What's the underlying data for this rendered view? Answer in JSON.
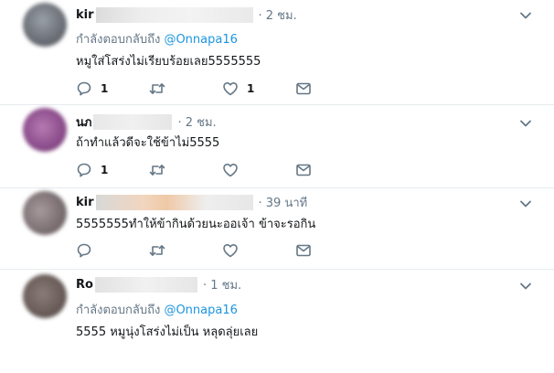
{
  "tweets": [
    {
      "name": "kir",
      "time": "· 2 ชม.",
      "replying_prefix": "กำลังตอบกลับถึง",
      "replying_handle": "@Onnapa16",
      "text": "หมูใส่โสร่งไม่เรียบร้อยเลย5555555",
      "reply_count": "1",
      "like_count": "1"
    },
    {
      "name": "นภ",
      "time": "· 2 ชม.",
      "text": "ถ้าทำแล้วดีจะใช้ข้าไม่5555",
      "reply_count": "1"
    },
    {
      "name": "kir",
      "time": "· 39 นาที",
      "text": "5555555ทำให้ข้ากินด้วยนะออเจ้า ข้าจะรอกิน"
    },
    {
      "name": "Ro",
      "time": "· 1 ชม.",
      "replying_prefix": "กำลังตอบกลับถึง",
      "replying_handle": "@Onnapa16",
      "text": "5555 หมูนุ่งโสร่งไม่เป็น หลุดลุ่ยเลย"
    }
  ]
}
